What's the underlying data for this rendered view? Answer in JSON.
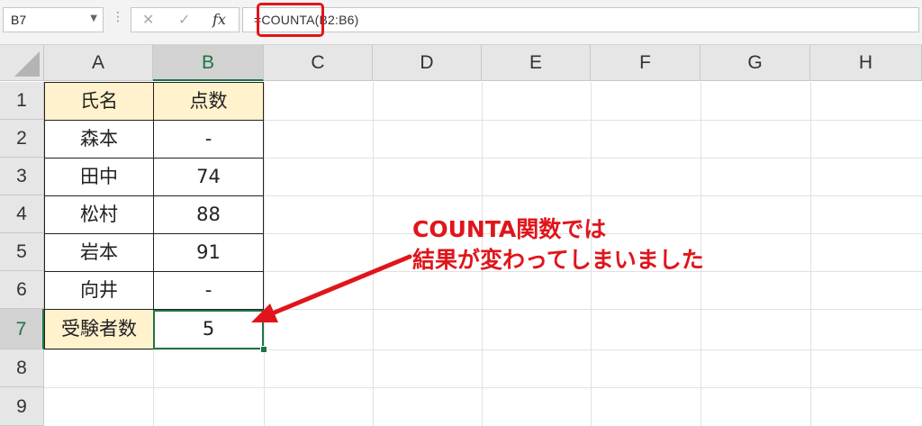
{
  "formula_bar": {
    "name_box": "B7",
    "fx_label": "fx",
    "cancel_glyph": "✕",
    "enter_glyph": "✓",
    "formula": "=COUNTA(B2:B6)"
  },
  "columns": [
    "A",
    "B",
    "C",
    "D",
    "E",
    "F",
    "G",
    "H"
  ],
  "rows": [
    "1",
    "2",
    "3",
    "4",
    "5",
    "6",
    "7",
    "8",
    "9"
  ],
  "table": {
    "header": {
      "name": "氏名",
      "score": "点数"
    },
    "entries": [
      {
        "name": "森本",
        "score": "-"
      },
      {
        "name": "田中",
        "score": "74"
      },
      {
        "name": "松村",
        "score": "88"
      },
      {
        "name": "岩本",
        "score": "91"
      },
      {
        "name": "向井",
        "score": "-"
      }
    ],
    "total_label": "受験者数",
    "total_value": "5"
  },
  "annotation": {
    "line1": "COUNTA関数では",
    "line2": "結果が変わってしまいました"
  },
  "colors": {
    "accent": "#e0151b",
    "header_fill": "#fff2cc",
    "selection": "#217346"
  }
}
